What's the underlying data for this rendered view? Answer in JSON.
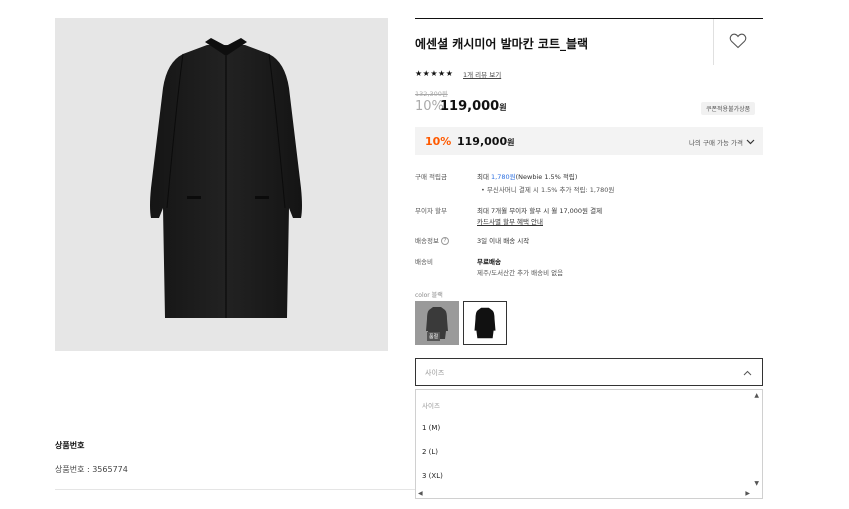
{
  "product": {
    "title": "에센셜 캐시미어 발마칸 코트_블랙",
    "stars": "★★★★★",
    "review_link": "1개 리뷰 보기",
    "original_price": "132,300원",
    "discount_rate": "10%",
    "price": "119,000",
    "price_unit": "원",
    "coupon_badge": "쿠폰적용불가상품",
    "my_price": {
      "discount": "10%",
      "price": "119,000",
      "unit": "원",
      "label": "나의 구매 가능 가격"
    },
    "number_title": "상품번호",
    "number_value": "상품번호 : 3565774"
  },
  "info": {
    "points_label": "구매 적립금",
    "points_prefix": "최대 ",
    "points_amount": "1,780원",
    "points_suffix": "(Newbie 1.5% 적립)",
    "points_sub": "•  무신사머니 결제 시 1.5% 추가 적립: 1,780원",
    "installment_label": "무이자 할부",
    "installment_text": "최대 7개월 무이자 할부 시 월 17,000원 결제",
    "installment_link": "카드사별 할부 혜택 안내",
    "delivery_label": "배송정보",
    "delivery_text": "3일 이내 배송 시작",
    "fee_label": "배송비",
    "fee_title": "무료배송",
    "fee_sub": "제주/도서산간 추가 배송비 없음"
  },
  "color": {
    "label": "color  블랙",
    "soldout_badge": "품절"
  },
  "size_select": {
    "placeholder": "사이즈",
    "options": [
      "사이즈",
      "1 (M)",
      "2 (L)",
      "3 (XL)"
    ]
  },
  "icons": [
    "heart-icon",
    "chevron-down-icon",
    "chevron-up-icon",
    "question-icon"
  ]
}
